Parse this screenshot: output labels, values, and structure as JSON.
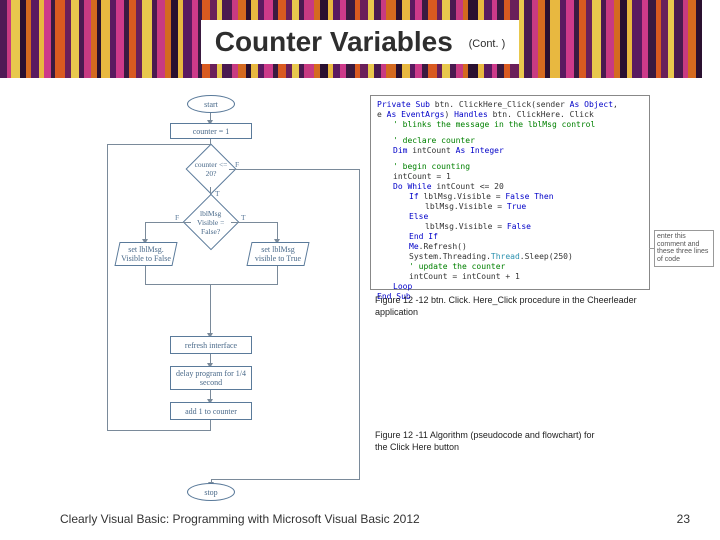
{
  "title": "Counter Variables",
  "title_suffix": "(Cont. )",
  "flowchart": {
    "start": "start",
    "stop": "stop",
    "counter_init": "counter = 1",
    "decision1": "counter <= 20?",
    "decision2": "lblMsg Visible = False?",
    "set_false": "set lblMsg. Visible to False",
    "set_true": "set lblMsg visible to True",
    "refresh": "refresh interface",
    "delay": "delay program for 1/4 second",
    "add": "add 1 to counter",
    "T": "T",
    "F": "F"
  },
  "code": {
    "l1a": "Private Sub",
    "l1b": " btn. ClickHere_Click(sender ",
    "l1c": "As Object",
    "l1d": ",",
    "l2a": "e ",
    "l2b": "As EventArgs",
    "l2c": ") ",
    "l2d": "Handles",
    "l2e": " btn. ClickHere. Click",
    "l3": "' blinks the message in the lblMsg control",
    "l4a": "' declare counter",
    "l5a": "Dim",
    "l5b": " intCount ",
    "l5c": "As Integer",
    "l6a": "' begin counting",
    "l7": "intCount = 1",
    "l8a": "Do While",
    "l8b": " intCount <= 20",
    "l9a": "If",
    "l9b": " lblMsg.Visible = ",
    "l9c": "False Then",
    "l10a": "lblMsg.Visible = ",
    "l10b": "True",
    "l11": "Else",
    "l12a": "lblMsg.Visible = ",
    "l12b": "False",
    "l13": "End If",
    "l14a": "Me",
    "l14b": ".Refresh()",
    "l15a": "System.Threading.",
    "l15b": "Thread",
    "l15c": ".Sleep(250)",
    "l16": "' update the counter",
    "l17": "intCount = intCount + 1",
    "l18": "Loop",
    "l19": "End Sub"
  },
  "annotation": "enter this comment and these three lines of code",
  "caption1": "Figure 12 -12 btn. Click. Here_Click procedure in the Cheerleader application",
  "caption2": "Figure 12 -11 Algorithm (pseudocode and flowchart) for the Click Here button",
  "footer": "Clearly Visual Basic: Programming with Microsoft Visual Basic 2012",
  "page": "23",
  "stripes": [
    {
      "w": 7,
      "c": "#501a55"
    },
    {
      "w": 4,
      "c": "#c83a82"
    },
    {
      "w": 9,
      "c": "#e8c84d"
    },
    {
      "w": 6,
      "c": "#2a1030"
    },
    {
      "w": 5,
      "c": "#d46a1f"
    },
    {
      "w": 8,
      "c": "#5a1a60"
    },
    {
      "w": 5,
      "c": "#e8b840"
    },
    {
      "w": 7,
      "c": "#cd3a8a"
    },
    {
      "w": 4,
      "c": "#3a1a40"
    },
    {
      "w": 10,
      "c": "#d95a20"
    },
    {
      "w": 6,
      "c": "#6a205a"
    },
    {
      "w": 8,
      "c": "#e8c84d"
    },
    {
      "w": 5,
      "c": "#4a1a50"
    },
    {
      "w": 7,
      "c": "#c83a82"
    },
    {
      "w": 6,
      "c": "#d46a1f"
    },
    {
      "w": 4,
      "c": "#2a1030"
    },
    {
      "w": 9,
      "c": "#e8b840"
    },
    {
      "w": 6,
      "c": "#5a1a60"
    },
    {
      "w": 8,
      "c": "#cd3a8a"
    },
    {
      "w": 5,
      "c": "#3a1a40"
    },
    {
      "w": 7,
      "c": "#d95a20"
    },
    {
      "w": 6,
      "c": "#6a205a"
    },
    {
      "w": 10,
      "c": "#e8c84d"
    },
    {
      "w": 5,
      "c": "#4a1a50"
    },
    {
      "w": 8,
      "c": "#c83a82"
    },
    {
      "w": 6,
      "c": "#d46a1f"
    },
    {
      "w": 7,
      "c": "#2a1030"
    },
    {
      "w": 5,
      "c": "#e8b840"
    },
    {
      "w": 9,
      "c": "#5a1a60"
    },
    {
      "w": 6,
      "c": "#cd3a8a"
    },
    {
      "w": 4,
      "c": "#3a1a40"
    },
    {
      "w": 8,
      "c": "#d95a20"
    },
    {
      "w": 7,
      "c": "#6a205a"
    },
    {
      "w": 5,
      "c": "#e8c84d"
    },
    {
      "w": 10,
      "c": "#4a1a50"
    },
    {
      "w": 6,
      "c": "#c83a82"
    },
    {
      "w": 8,
      "c": "#d46a1f"
    },
    {
      "w": 5,
      "c": "#2a1030"
    },
    {
      "w": 7,
      "c": "#e8b840"
    },
    {
      "w": 6,
      "c": "#5a1a60"
    },
    {
      "w": 9,
      "c": "#cd3a8a"
    },
    {
      "w": 5,
      "c": "#3a1a40"
    },
    {
      "w": 8,
      "c": "#d95a20"
    },
    {
      "w": 6,
      "c": "#6a205a"
    },
    {
      "w": 7,
      "c": "#e8c84d"
    },
    {
      "w": 5,
      "c": "#4a1a50"
    },
    {
      "w": 10,
      "c": "#c83a82"
    },
    {
      "w": 6,
      "c": "#d46a1f"
    },
    {
      "w": 8,
      "c": "#2a1030"
    },
    {
      "w": 5,
      "c": "#e8b840"
    },
    {
      "w": 7,
      "c": "#5a1a60"
    },
    {
      "w": 6,
      "c": "#cd3a8a"
    },
    {
      "w": 9,
      "c": "#3a1a40"
    },
    {
      "w": 5,
      "c": "#d95a20"
    },
    {
      "w": 8,
      "c": "#6a205a"
    },
    {
      "w": 6,
      "c": "#e8c84d"
    },
    {
      "w": 7,
      "c": "#4a1a50"
    },
    {
      "w": 5,
      "c": "#c83a82"
    },
    {
      "w": 10,
      "c": "#d46a1f"
    },
    {
      "w": 6,
      "c": "#2a1030"
    },
    {
      "w": 8,
      "c": "#e8b840"
    },
    {
      "w": 5,
      "c": "#5a1a60"
    },
    {
      "w": 7,
      "c": "#cd3a8a"
    },
    {
      "w": 6,
      "c": "#3a1a40"
    },
    {
      "w": 9,
      "c": "#d95a20"
    },
    {
      "w": 5,
      "c": "#6a205a"
    },
    {
      "w": 8,
      "c": "#e8c84d"
    },
    {
      "w": 6,
      "c": "#4a1a50"
    },
    {
      "w": 7,
      "c": "#c83a82"
    },
    {
      "w": 5,
      "c": "#d46a1f"
    },
    {
      "w": 10,
      "c": "#2a1030"
    },
    {
      "w": 6,
      "c": "#e8b840"
    },
    {
      "w": 8,
      "c": "#5a1a60"
    },
    {
      "w": 5,
      "c": "#cd3a8a"
    },
    {
      "w": 7,
      "c": "#3a1a40"
    },
    {
      "w": 6,
      "c": "#d95a20"
    },
    {
      "w": 9,
      "c": "#6a205a"
    },
    {
      "w": 5,
      "c": "#e8c84d"
    },
    {
      "w": 8,
      "c": "#4a1a50"
    },
    {
      "w": 6,
      "c": "#c83a82"
    },
    {
      "w": 7,
      "c": "#d46a1f"
    },
    {
      "w": 5,
      "c": "#2a1030"
    },
    {
      "w": 10,
      "c": "#e8b840"
    },
    {
      "w": 6,
      "c": "#5a1a60"
    },
    {
      "w": 8,
      "c": "#cd3a8a"
    },
    {
      "w": 5,
      "c": "#3a1a40"
    },
    {
      "w": 7,
      "c": "#d95a20"
    },
    {
      "w": 6,
      "c": "#6a205a"
    },
    {
      "w": 9,
      "c": "#e8c84d"
    },
    {
      "w": 5,
      "c": "#4a1a50"
    },
    {
      "w": 8,
      "c": "#c83a82"
    },
    {
      "w": 6,
      "c": "#d46a1f"
    },
    {
      "w": 7,
      "c": "#2a1030"
    },
    {
      "w": 5,
      "c": "#e8b840"
    },
    {
      "w": 10,
      "c": "#5a1a60"
    },
    {
      "w": 6,
      "c": "#cd3a8a"
    },
    {
      "w": 8,
      "c": "#3a1a40"
    },
    {
      "w": 5,
      "c": "#d95a20"
    },
    {
      "w": 7,
      "c": "#6a205a"
    },
    {
      "w": 6,
      "c": "#e8c84d"
    },
    {
      "w": 9,
      "c": "#4a1a50"
    },
    {
      "w": 5,
      "c": "#c83a82"
    },
    {
      "w": 8,
      "c": "#d46a1f"
    },
    {
      "w": 6,
      "c": "#2a1030"
    }
  ]
}
